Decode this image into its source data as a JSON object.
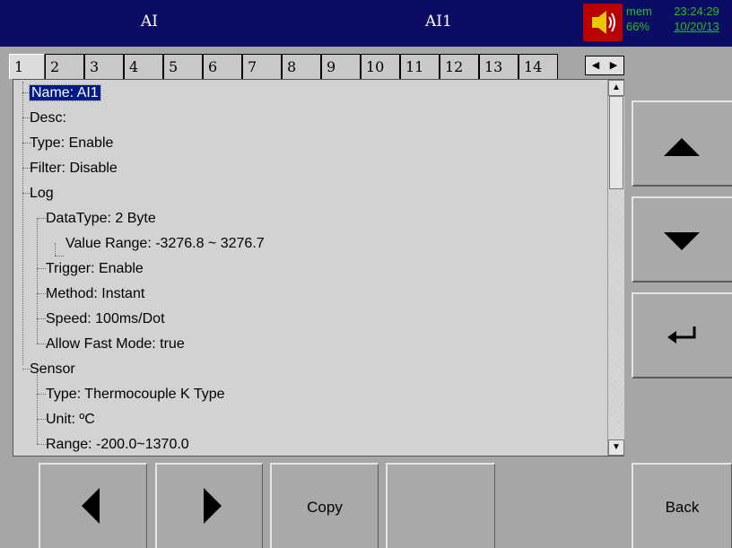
{
  "header": {
    "left_title": "AI",
    "center_title": "AI1",
    "mem_label": "mem",
    "mem_value": "66%",
    "time": "23:24:29",
    "date": "10/20/13"
  },
  "tabs": [
    "1",
    "2",
    "3",
    "4",
    "5",
    "6",
    "7",
    "8",
    "9",
    "10",
    "11",
    "12",
    "13",
    "14"
  ],
  "tree": {
    "name": "Name: AI1",
    "desc": "Desc:",
    "type": "Type: Enable",
    "filter": "Filter: Disable",
    "log": "Log",
    "datatype": "DataType: 2 Byte",
    "value_range": "Value Range: -3276.8 ~ 3276.7",
    "trigger": "Trigger: Enable",
    "method": "Method: Instant",
    "speed": "Speed: 100ms/Dot",
    "fast_mode": "Allow Fast Mode: true",
    "sensor": "Sensor",
    "sensor_type": "Type: Thermocouple K Type",
    "unit": "Unit: ºC",
    "range": "Range: -200.0~1370.0"
  },
  "buttons": {
    "copy": "Copy",
    "back": "Back"
  }
}
